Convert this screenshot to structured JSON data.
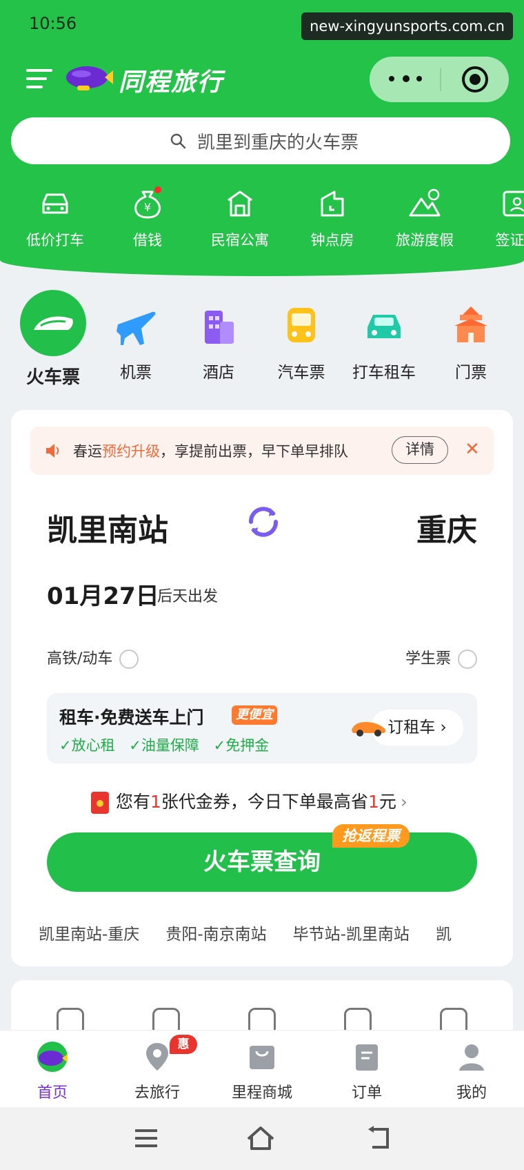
{
  "status_bar": {
    "time": "10:56",
    "url": "new-xingyunsports.com.cn"
  },
  "header": {
    "brand": "同程旅行"
  },
  "search": {
    "placeholder": "凯里到重庆的火车票"
  },
  "quick_services": [
    {
      "label": "低价打车",
      "icon": "car-icon"
    },
    {
      "label": "借钱",
      "icon": "money-bag-icon"
    },
    {
      "label": "民宿公寓",
      "icon": "house-icon"
    },
    {
      "label": "钟点房",
      "icon": "clock-house-icon"
    },
    {
      "label": "旅游度假",
      "icon": "mountain-icon"
    },
    {
      "label": "签证办",
      "icon": "id-card-icon"
    }
  ],
  "categories": [
    {
      "label": "火车票",
      "icon": "train-icon",
      "active": true
    },
    {
      "label": "机票",
      "icon": "plane-icon"
    },
    {
      "label": "酒店",
      "icon": "hotel-icon"
    },
    {
      "label": "汽车票",
      "icon": "bus-icon"
    },
    {
      "label": "打车租车",
      "icon": "taxi-icon"
    },
    {
      "label": "门票",
      "icon": "temple-icon"
    }
  ],
  "notice": {
    "prefix": "春运",
    "highlight": "预约升级",
    "suffix": "，享提前出票，早下单早排队",
    "detail_label": "详情",
    "close_label": "✕"
  },
  "trip": {
    "from": "凯里南站",
    "to": "重庆",
    "date": "01月27日",
    "date_note": "后天出发",
    "option_highspeed": "高铁/动车",
    "option_student": "学生票"
  },
  "rental": {
    "title": "租车·免费送车上门",
    "tag": "更便宜",
    "features": [
      "✓放心租",
      "✓油量保障",
      "✓免押金"
    ],
    "button": "订租车 ›"
  },
  "coupon": {
    "part1": "您有",
    "count": "1",
    "part2": "张代金券，今日下单最高省",
    "amount": "1",
    "part3": "元",
    "chevron": "›"
  },
  "query": {
    "button": "火车票查询",
    "promo": "抢返程票"
  },
  "history": [
    "凯里南站-重庆",
    "贵阳-南京南站",
    "毕节站-凯里南站",
    "凯"
  ],
  "tabs": [
    {
      "label": "首页",
      "icon": "home-blimp-icon",
      "active": true
    },
    {
      "label": "去旅行",
      "icon": "location-pin-icon",
      "badge": "惠"
    },
    {
      "label": "里程商城",
      "icon": "shopping-bag-icon"
    },
    {
      "label": "订单",
      "icon": "order-icon"
    },
    {
      "label": "我的",
      "icon": "profile-icon"
    }
  ],
  "colors": {
    "brand_green": "#24c249",
    "accent_orange": "#f06a3a",
    "active_tab": "#7a2fd0"
  }
}
